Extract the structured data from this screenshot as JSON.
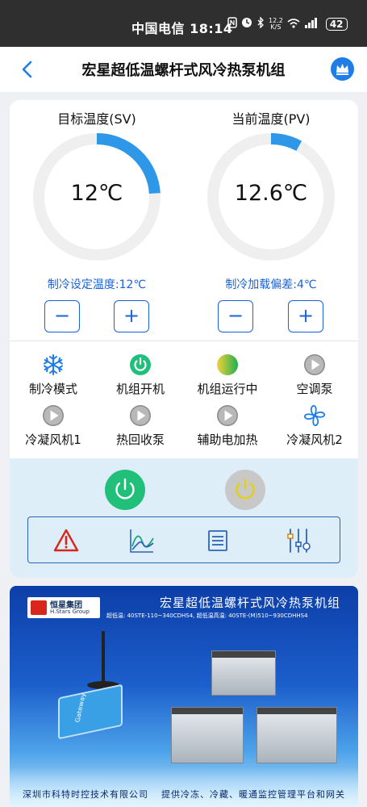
{
  "status_bar": {
    "carrier_time": "中国电信 18:14",
    "speed_top": "12.2",
    "speed_bottom": "K/S",
    "battery": "42"
  },
  "nav": {
    "title": "宏星超低温螺杆式风冷热泵机组"
  },
  "target": {
    "label": "目标温度(SV)",
    "value": "12℃",
    "arc_fraction": 0.24,
    "info": "制冷设定温度:12℃",
    "minus": "−",
    "plus": "+"
  },
  "current": {
    "label": "当前温度(PV)",
    "value": "12.6℃",
    "arc_fraction": 0.08,
    "info": "制冷加载偏差:4℃",
    "minus": "−",
    "plus": "+"
  },
  "status_items": [
    {
      "icon": "snowflake-icon",
      "label": "制冷模式"
    },
    {
      "icon": "power-on-icon",
      "label": "机组开机"
    },
    {
      "icon": "running-ball-icon",
      "label": "机组运行中"
    },
    {
      "icon": "play-gray-icon",
      "label": "空调泵"
    },
    {
      "icon": "play-gray-icon",
      "label": "冷凝风机1"
    },
    {
      "icon": "play-gray-icon",
      "label": "热回收泵"
    },
    {
      "icon": "play-gray-icon",
      "label": "辅助电加热"
    },
    {
      "icon": "fan-icon",
      "label": "冷凝风机2"
    }
  ],
  "colors": {
    "accent": "#1a64d8",
    "gauge_arc": "#2f97e8",
    "gauge_track": "#efefef",
    "power_on": "#21c07a",
    "power_off": "#c8c8c8",
    "warning": "#d9261c"
  },
  "toolbar": [
    "warning-icon",
    "curve-chart-icon",
    "list-icon",
    "settings-sliders-icon"
  ],
  "banner": {
    "logo_zh": "恒星集团",
    "logo_en": "H.Stars Group",
    "title": "宏星超低温螺杆式风冷热泵机组",
    "subtitle": "超低温: 40STE-110~340CDHS4, 超低温高温: 40STE-(M)510~930CDHHS4",
    "device_label": "Gateway",
    "footer_left": "深圳市科特时控技术有限公司",
    "footer_right": "提供冷冻、冷藏、暖通监控管理平台和网关"
  }
}
